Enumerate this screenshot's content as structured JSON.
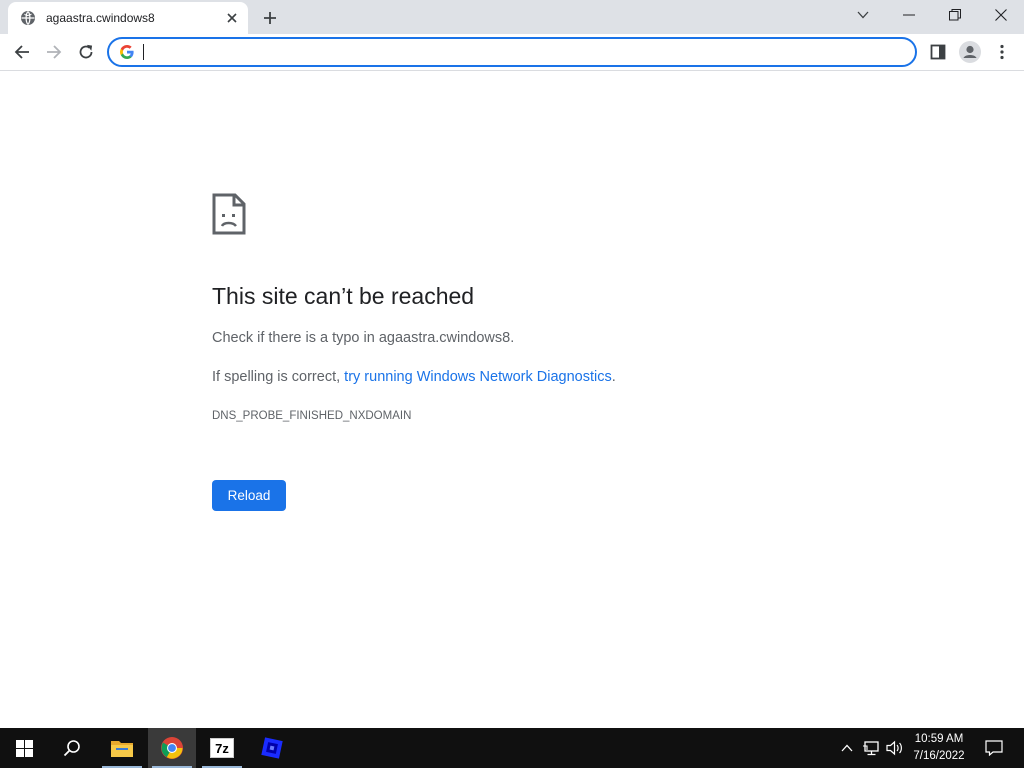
{
  "browser": {
    "tab": {
      "title": "agaastra.cwindows8"
    },
    "omnibox": {
      "value": "",
      "placeholder": ""
    }
  },
  "error_page": {
    "title": "This site can’t be reached",
    "line1": "Check if there is a typo in agaastra.cwindows8.",
    "line2_prefix": "If spelling is correct, ",
    "line2_link": "try running Windows Network Diagnostics",
    "line2_suffix": ".",
    "error_code": "DNS_PROBE_FINISHED_NXDOMAIN",
    "reload_label": "Reload"
  },
  "taskbar": {
    "apps": [
      "windows-start-icon",
      "search-icon",
      "file-explorer-icon",
      "chrome-icon",
      "7zip-icon",
      "app-icon"
    ],
    "seven_zip_label": "7z",
    "clock": {
      "time": "10:59 AM",
      "date": "7/16/2022"
    }
  },
  "colors": {
    "accent": "#1a73e8",
    "tabstrip": "#dee1e6",
    "taskbar": "#101010",
    "text_primary": "#202124",
    "text_secondary": "#5f6368"
  }
}
